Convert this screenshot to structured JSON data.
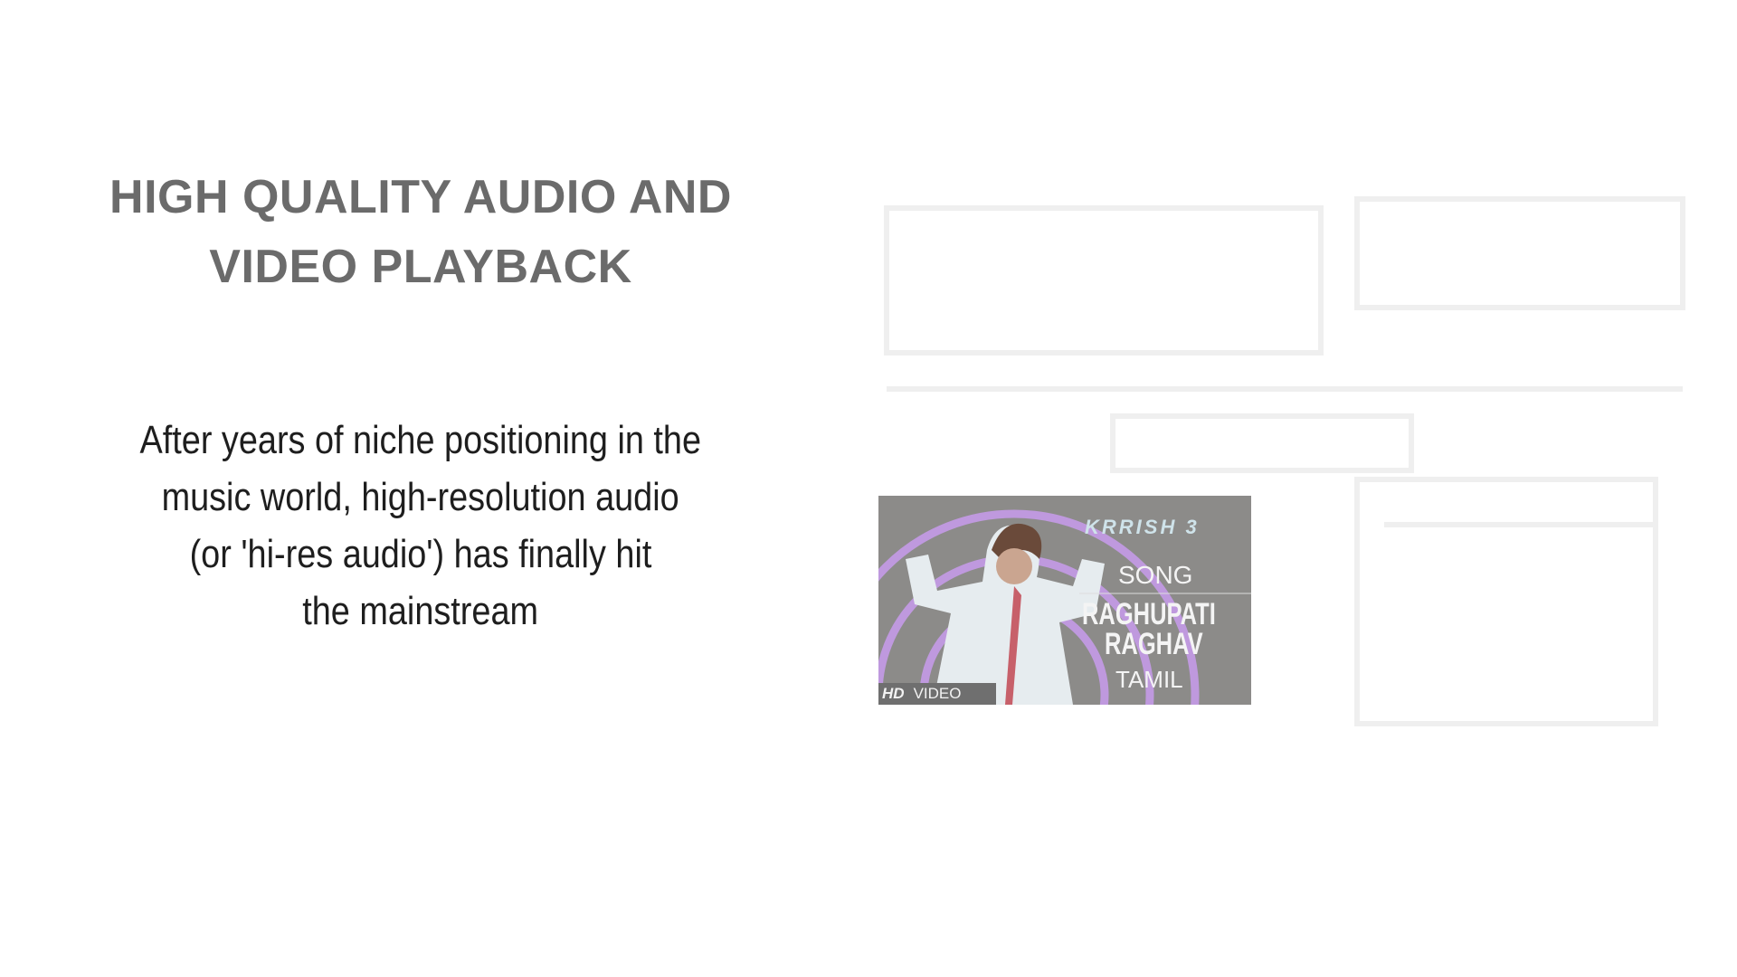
{
  "heading": {
    "line1": "HIGH QUALITY AUDIO AND",
    "line2": "VIDEO PLAYBACK"
  },
  "body": {
    "lines": [
      "After years of niche positioning in the",
      "music world, high-resolution audio",
      "(or 'hi-res audio') has finally hit",
      "the mainstream"
    ]
  },
  "thumbnail": {
    "logo": "KRRISH 3",
    "label": "SONG",
    "title_line1": "RAGHUPATI",
    "title_line2": "RAGHAV",
    "language": "TAMIL",
    "badge_hd": "HD",
    "badge_video": "VIDEO"
  },
  "colors": {
    "heading": "#6b6b6b",
    "body": "#1e1e1e",
    "thumb_bg": "#8c8b89",
    "arc": "#c59be8"
  }
}
